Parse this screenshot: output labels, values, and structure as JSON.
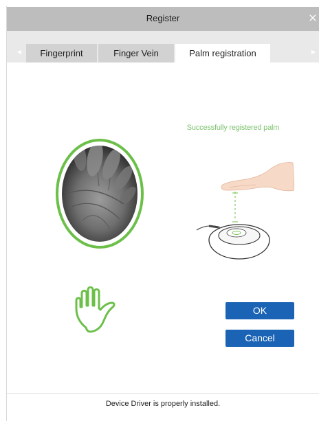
{
  "dialog": {
    "title": "Register",
    "close_icon": "×"
  },
  "tabs": [
    {
      "label": "Fingerprint"
    },
    {
      "label": "Finger Vein"
    },
    {
      "label": "Palm registration",
      "active": true
    }
  ],
  "registration": {
    "status_message": "Successfully registered palm",
    "status_color": "#7ec26f",
    "ring_color": "#6cc04a"
  },
  "buttons": {
    "ok_label": "OK",
    "cancel_label": "Cancel",
    "color": "#1a63b5"
  },
  "footer": {
    "message": "Device Driver is properly installed."
  },
  "icons": [
    "close-icon",
    "tab-scroll-left-icon",
    "tab-scroll-right-icon",
    "hand-icon"
  ]
}
